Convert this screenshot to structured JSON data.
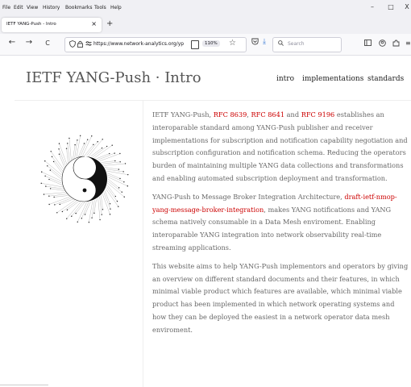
{
  "menubar": {
    "items": [
      "File",
      "Edit",
      "View",
      "History",
      "Bookmarks",
      "Tools",
      "Help"
    ]
  },
  "window_controls": {
    "minimize": "–",
    "maximize": "□",
    "close": "X"
  },
  "tab": {
    "title": "IETF YANG-Push - Intro",
    "close": "×",
    "new_tab": "+"
  },
  "nav": {
    "back": "←",
    "forward": "→",
    "reload": "C",
    "url": "https://www.network-analytics.org/yp",
    "zoom": "110%",
    "search_placeholder": "Search"
  },
  "icons": {
    "shield": "shield-icon",
    "lock": "lock-icon",
    "permissions": "permissions-icon",
    "reader": "reader-view-icon",
    "bookmark": "bookmark-star-icon",
    "pocket": "pocket-icon",
    "downloads": "download-icon",
    "search": "search-icon",
    "library": "library-icon",
    "account": "account-icon",
    "extensions": "extensions-icon",
    "menu": "hamburger-menu-icon"
  },
  "site": {
    "title": "IETF YANG-Push · Intro",
    "nav": [
      "intro",
      "implementations",
      "standards"
    ]
  },
  "content": {
    "p1": {
      "t1": "IETF YANG-Push, ",
      "l1": "RFC 8639",
      "t2": ", ",
      "l2": "RFC 8641",
      "t3": " and ",
      "l3": "RFC 9196",
      "t4": " establishes an interoparable standard among YANG-Push publisher and receiver implementations for subscription and notification capability negotiation and subscription configuration and notification schema. Reducing the operators burden of maintaining multiple YANG data collections and transformations and enabling automated subscription deployment and transformation."
    },
    "p2": {
      "t1": "YANG-Push to Message Broker Integration Architecture, ",
      "l1": "draft-ietf-nmop-yang-message-broker-integration",
      "t2": ", makes YANG notifications and YANG schema natively consumable in a Data Mesh enviroment. Enabling interoparable YANG integration into network observability real-time streaming applications."
    },
    "p3": "This website aims to help YANG-Push implementors and operators by giving an overview on different standard documents and their features, in which minimal viable product which features are available, which minimal viable product has been implemented in which network operating systems and how they can be deployed the easiest in a network operator data mesh enviroment."
  },
  "colors": {
    "link": "#cc0000",
    "body_text": "#666666",
    "title_text": "#555555",
    "chrome_bg": "#f0f0f4"
  }
}
